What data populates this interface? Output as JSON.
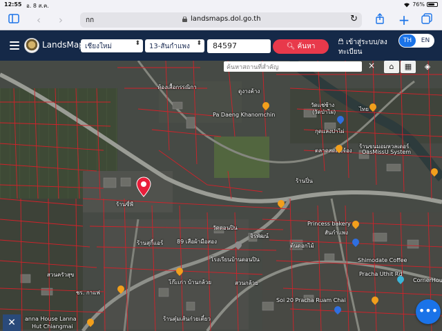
{
  "status_bar": {
    "time": "12:55",
    "date": "อ. 8 ส.ค.",
    "battery": "76%",
    "battery_level": 0.76
  },
  "browser": {
    "text_size_label": "กก",
    "url": "landsmaps.dol.go.th",
    "icons": [
      "sidebar-icon",
      "back-icon",
      "forward-icon",
      "reload-icon",
      "share-icon",
      "new-tab-icon",
      "tabs-icon"
    ]
  },
  "header": {
    "brand": "LandsMaps",
    "province": "เชียงใหม่",
    "district": "13-สันกำแพง",
    "parcel_number": "84597",
    "search_label": "ค้นหา",
    "login_line1": "เข้าสู่ระบบ/ลง",
    "login_line2": "ทะเบียน",
    "lang_th": "TH",
    "lang_en": "EN",
    "accent": "#152948",
    "search_color": "#e8394b"
  },
  "map": {
    "search_placeholder": "ค้นหาสถานที่สำคัญ",
    "close_label": "×",
    "labels": {
      "market_top": "ห้องเสื้อกรรณิกา",
      "nursery": "ดูงางค้าง",
      "pa_daeng": "Pa Daeng Khanomchin",
      "temple_a": "วัดแช่ช้าง",
      "temple_b": "(วัดป่าไผ่)",
      "sweet_shop": "ร้านขนมอมหวลเดอร์",
      "oasis": "OasMissU System",
      "kaen": "กุดแลงปาไผ่",
      "market_center": "ตลาดสดแม่จ้อง",
      "wat_mon": "วัดดอนปิน",
      "princess": "Princess bakery",
      "princess_sub": "สันกำแพง",
      "shimodate": "Shimodate Coffee",
      "corner": "CornerHouse",
      "school": "โรงเรียนบ้านดอนปิน",
      "cafe_89": "89 เสือผ้ามือสอง",
      "shop_left": "ร้านสุกี้แอร์",
      "sanphi": "ร้านปิ่น",
      "ko_kao": "โก๊ะเก่า บ้านกล้วย",
      "suan_kaew": "สวนครัวสุข",
      "house_lanna": "anna House Lanna",
      "hut": "Hut Chiangmai",
      "tam": "ร้านตุ๋มเส้นก๋วยเตี๋ยว",
      "soi_20": "Soi 20 Pracha Ruam Chai",
      "pracha": "Pracha Uthit Rd",
      "kaikan": "ชร. กาแฟ",
      "dokmai": "ต้นดอกไม้",
      "chiangmai_sub": "ร้านซี่พี",
      "jiraphat": "จิรพัฒน์",
      "suan": "สวนกล้วย",
      "thai_tea": "ไทย"
    }
  }
}
